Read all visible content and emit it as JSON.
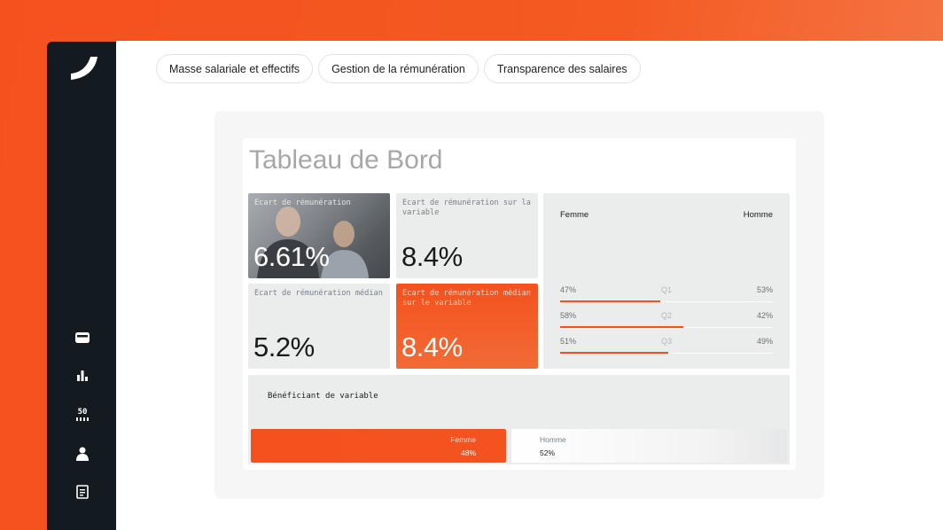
{
  "tabs": [
    {
      "label": "Masse salariale et effectifs"
    },
    {
      "label": "Gestion de la rémunération"
    },
    {
      "label": "Transparence des salaires"
    }
  ],
  "sidebar": {
    "icons": [
      "wallet-icon",
      "bar-chart-icon",
      "pay-gap-index-icon",
      "user-icon",
      "document-icon"
    ],
    "index_text": "50"
  },
  "dashboard": {
    "title": "Tableau de Bord",
    "cards": [
      {
        "label": "Ecart de rémunération",
        "value": "6.61%"
      },
      {
        "label": "Ecart de rémunération sur la variable",
        "value": "8.4%"
      },
      {
        "label": "Ecart de rémunération médian",
        "value": "5.2%"
      },
      {
        "label": "Ecart de rémunération médian sur le variable",
        "value": "8.4%"
      }
    ],
    "quartiles": {
      "female_label": "Femme",
      "male_label": "Homme",
      "rows": [
        {
          "quartile": "Q1",
          "female": "47%",
          "male": "53%",
          "female_share": 0.47
        },
        {
          "quartile": "Q2",
          "female": "58%",
          "male": "42%",
          "female_share": 0.58
        },
        {
          "quartile": "Q3",
          "female": "51%",
          "male": "49%",
          "female_share": 0.51
        }
      ]
    },
    "beneficiaries": {
      "title": "Bénéficiant de variable",
      "female_label": "Femme",
      "female_value": "48%",
      "female_share": 0.48,
      "male_label": "Homme",
      "male_value": "52%",
      "male_share": 0.52
    }
  },
  "colors": {
    "accent": "#f4511e",
    "sidebar": "#141b20",
    "card_bg": "#ebecec"
  }
}
